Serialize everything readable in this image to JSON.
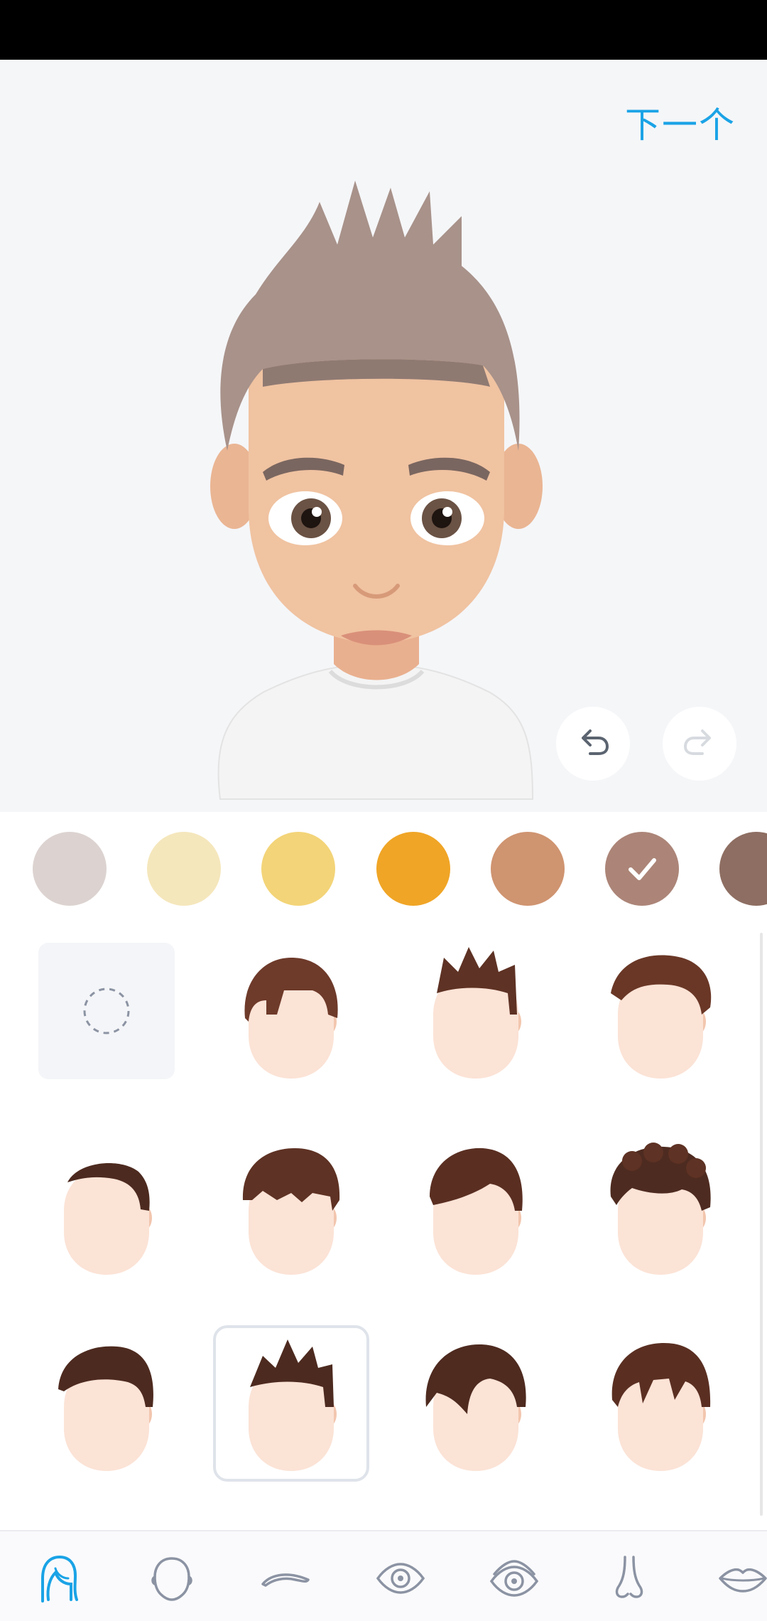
{
  "header": {
    "next_label": "下一个"
  },
  "controls": {
    "undo_icon": "undo-icon",
    "redo_icon": "redo-icon"
  },
  "colors": {
    "accent": "#1aa3e6",
    "swatches": [
      "#dcd3d0",
      "#f5e7bc",
      "#f3d478",
      "#f0a526",
      "#cf9470",
      "#ac8578",
      "#8e6e62"
    ],
    "selected_swatch_index": 5
  },
  "hair_styles": {
    "items": [
      "none",
      "style-1",
      "style-2",
      "style-3",
      "style-4",
      "style-5",
      "style-6",
      "style-7",
      "style-8",
      "style-9",
      "style-10",
      "style-11"
    ],
    "selected_index": 9
  },
  "tabs": [
    "hair-icon",
    "face-shape-icon",
    "eyebrow-icon",
    "eye-icon",
    "eye-detail-icon",
    "nose-icon",
    "lips-icon"
  ],
  "active_tab_index": 0
}
